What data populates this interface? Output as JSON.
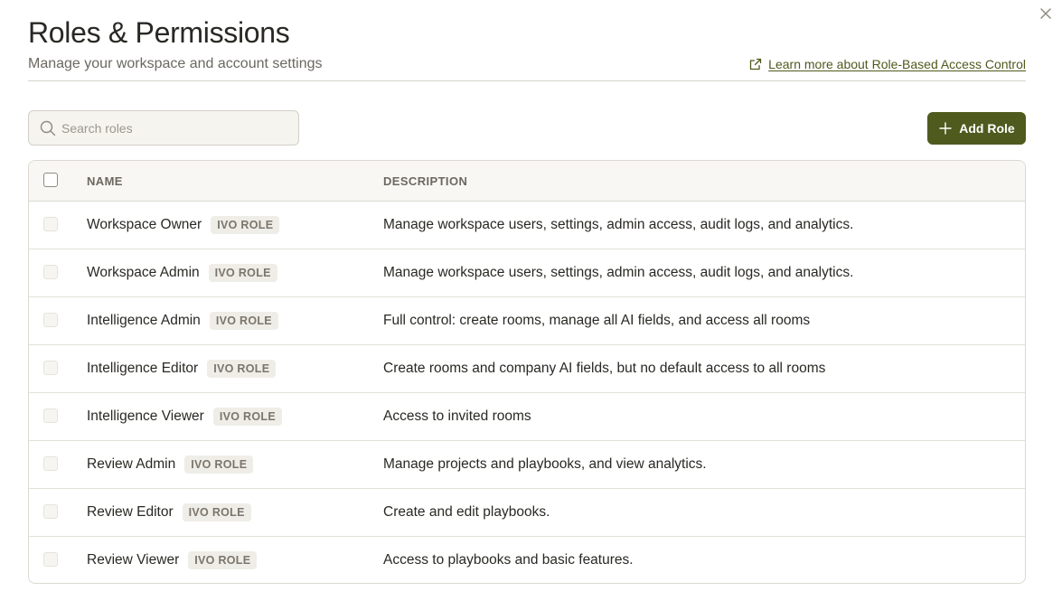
{
  "header": {
    "title": "Roles & Permissions",
    "subtitle": "Manage your workspace and account settings",
    "learn_link": "Learn more about Role-Based Access Control"
  },
  "toolbar": {
    "search_placeholder": "Search roles",
    "search_value": "",
    "add_label": "Add Role"
  },
  "table": {
    "columns": [
      "NAME",
      "DESCRIPTION"
    ],
    "rows": [
      {
        "name": "Workspace Owner",
        "badge": "IVO ROLE",
        "description": "Manage workspace users, settings, admin access, audit logs, and analytics."
      },
      {
        "name": "Workspace Admin",
        "badge": "IVO ROLE",
        "description": "Manage workspace users, settings, admin access, audit logs, and analytics."
      },
      {
        "name": "Intelligence Admin",
        "badge": "IVO ROLE",
        "description": "Full control: create rooms, manage all AI fields, and access all rooms"
      },
      {
        "name": "Intelligence Editor",
        "badge": "IVO ROLE",
        "description": "Create rooms and company AI fields, but no default access to all rooms"
      },
      {
        "name": "Intelligence Viewer",
        "badge": "IVO ROLE",
        "description": "Access to invited rooms"
      },
      {
        "name": "Review Admin",
        "badge": "IVO ROLE",
        "description": "Manage projects and playbooks, and view analytics."
      },
      {
        "name": "Review Editor",
        "badge": "IVO ROLE",
        "description": "Create and edit playbooks."
      },
      {
        "name": "Review Viewer",
        "badge": "IVO ROLE",
        "description": "Access to playbooks and basic features."
      }
    ]
  },
  "colors": {
    "accent": "#4f5a1e",
    "text": "#2a2824",
    "muted": "#6b6860",
    "badge_bg": "#efede7"
  },
  "icons": [
    "close-icon",
    "external-link-icon",
    "search-icon",
    "plus-icon"
  ]
}
